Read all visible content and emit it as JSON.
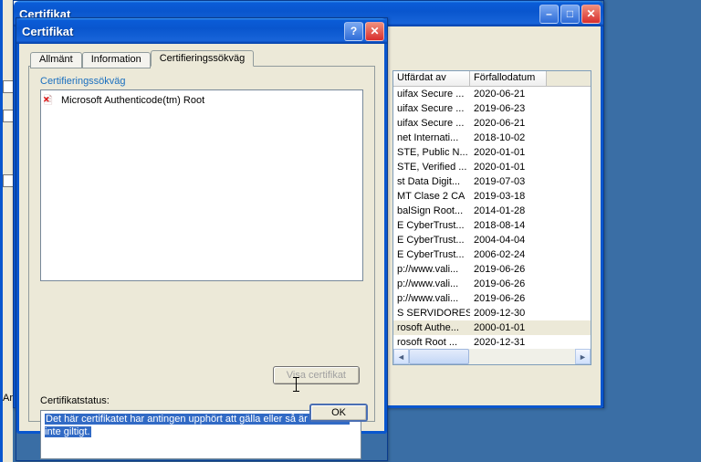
{
  "backWindow": {
    "title": "Certifikat",
    "columns": {
      "issuedBy": "Utfärdat av",
      "expiry": "Förfallodatum"
    },
    "rows": [
      {
        "issuedBy": "uifax Secure ...",
        "expiry": "2020-06-21"
      },
      {
        "issuedBy": "uifax Secure ...",
        "expiry": "2019-06-23"
      },
      {
        "issuedBy": "uifax Secure ...",
        "expiry": "2020-06-21"
      },
      {
        "issuedBy": "net Internati...",
        "expiry": "2018-10-02"
      },
      {
        "issuedBy": "STE, Public N...",
        "expiry": "2020-01-01"
      },
      {
        "issuedBy": "STE, Verified ...",
        "expiry": "2020-01-01"
      },
      {
        "issuedBy": "st Data Digit...",
        "expiry": "2019-07-03"
      },
      {
        "issuedBy": "MT Clase 2 CA",
        "expiry": "2019-03-18"
      },
      {
        "issuedBy": "balSign Root...",
        "expiry": "2014-01-28"
      },
      {
        "issuedBy": "E CyberTrust...",
        "expiry": "2018-08-14"
      },
      {
        "issuedBy": "E CyberTrust...",
        "expiry": "2004-04-04"
      },
      {
        "issuedBy": "E CyberTrust...",
        "expiry": "2006-02-24"
      },
      {
        "issuedBy": "p://www.vali...",
        "expiry": "2019-06-26"
      },
      {
        "issuedBy": "p://www.vali...",
        "expiry": "2019-06-26"
      },
      {
        "issuedBy": "p://www.vali...",
        "expiry": "2019-06-26"
      },
      {
        "issuedBy": "S SERVIDORES",
        "expiry": "2009-12-30"
      },
      {
        "issuedBy": "rosoft Authe...",
        "expiry": "2000-01-01",
        "selected": true
      },
      {
        "issuedBy": "rosoft Root ...",
        "expiry": "2020-12-31"
      }
    ]
  },
  "dialog": {
    "title": "Certifikat",
    "tabs": {
      "general": "Allmänt",
      "info": "Information",
      "path": "Certifieringssökväg"
    },
    "pathLabel": "Certifieringssökväg",
    "pathItem": "Microsoft Authenticode(tm) Root",
    "viewCert": "Visa certifikat",
    "statusLabel": "Certifikatstatus:",
    "statusText": "Det här certifikatet har antingen upphört att gälla eller så är det ännu inte giltigt.",
    "ok": "OK"
  },
  "leftStripLabel": "Ar"
}
